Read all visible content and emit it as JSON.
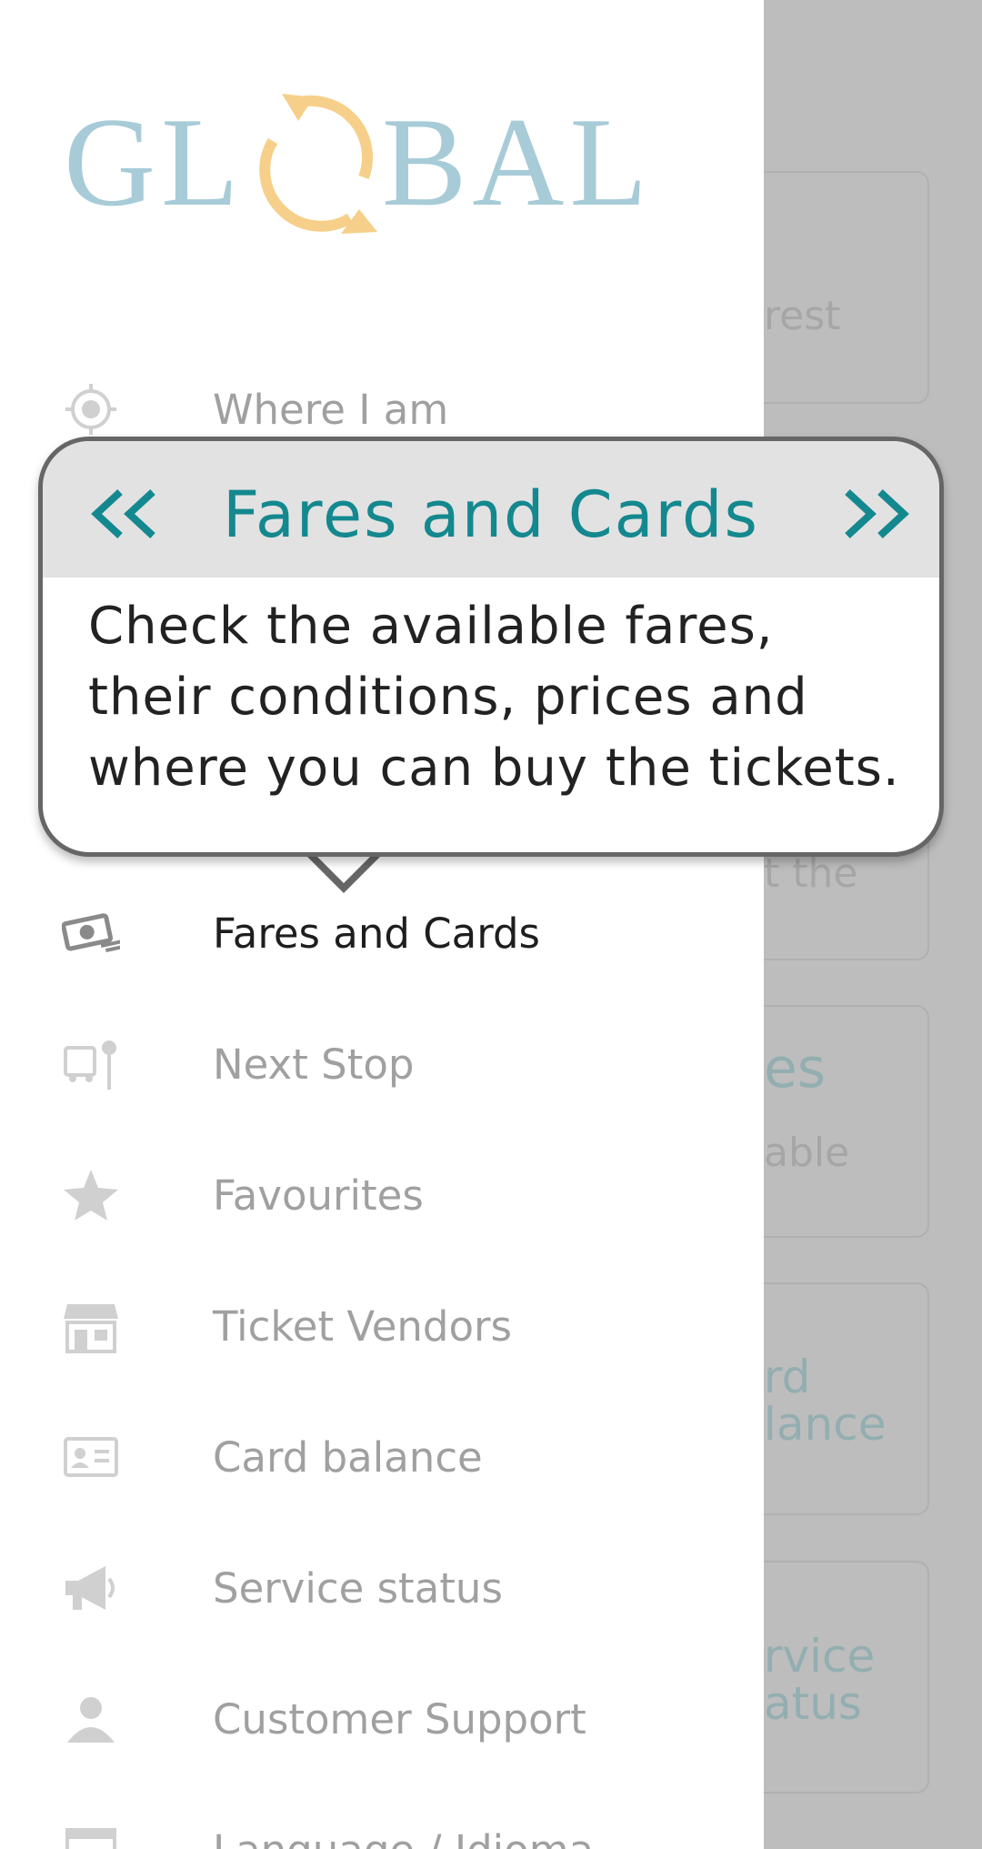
{
  "brand": {
    "logo_text": "GLOBAL"
  },
  "background": {
    "cards": [
      {
        "lines": [
          "rest"
        ]
      },
      {
        "lines": [
          "t the"
        ]
      },
      {
        "lines": [
          "es",
          "able"
        ]
      },
      {
        "lines": [
          "rd",
          "lance"
        ]
      },
      {
        "lines": [
          "rvice",
          "atus"
        ]
      }
    ]
  },
  "menu": {
    "items": [
      {
        "label": "Where I am",
        "icon": "location-target-icon"
      },
      {
        "label": "Fares and Cards",
        "icon": "ticket-money-icon",
        "active": true
      },
      {
        "label": "Next Stop",
        "icon": "bus-stop-icon"
      },
      {
        "label": "Favourites",
        "icon": "star-icon"
      },
      {
        "label": "Ticket Vendors",
        "icon": "store-icon"
      },
      {
        "label": "Card balance",
        "icon": "id-card-icon"
      },
      {
        "label": "Service status",
        "icon": "megaphone-icon"
      },
      {
        "label": "Customer Support",
        "icon": "person-icon"
      },
      {
        "label": "Language / Idioma",
        "icon": "window-icon"
      }
    ]
  },
  "tooltip": {
    "title": "Fares and Cards",
    "prev_glyph": "<<",
    "next_glyph": ">>",
    "body_lines": [
      "Check the available fares,",
      "their conditions, prices and",
      "where you can buy the tickets."
    ]
  },
  "colors": {
    "accent": "#14888f",
    "overlay": "#bdbdbd",
    "menu_text": "#a0a0a0",
    "active_text": "#1e1e1e"
  }
}
